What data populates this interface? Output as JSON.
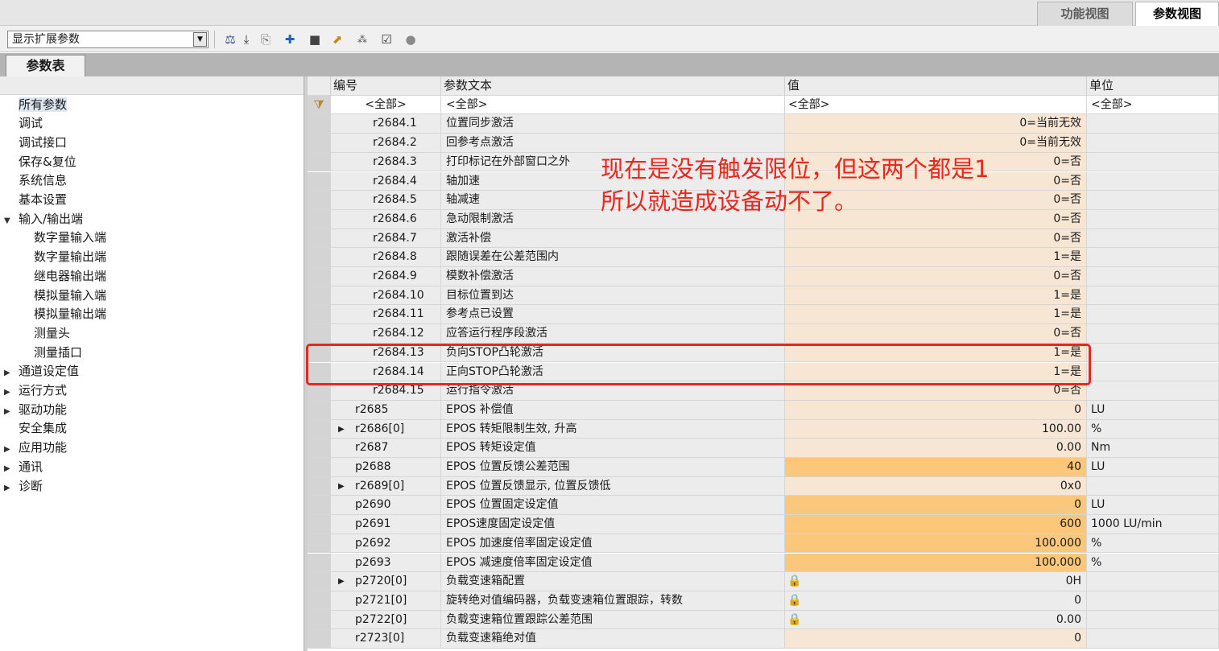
{
  "view_tabs": [
    "功能视图",
    "参数视图"
  ],
  "toolbar": {
    "dropdown_value": "显示扩展参数",
    "icons": [
      "compare-icon",
      "download-icon",
      "copy-to-icon",
      "new-icon",
      "save-icon",
      "export-icon",
      "sort-icon",
      "checkbox-icon",
      "status-dot-icon"
    ]
  },
  "tab_label": "参数表",
  "tree": [
    {
      "label": "所有参数",
      "level": 0,
      "arrow": "",
      "selected": true
    },
    {
      "label": "调试",
      "level": 0,
      "arrow": ""
    },
    {
      "label": "调试接口",
      "level": 0,
      "arrow": ""
    },
    {
      "label": "保存&复位",
      "level": 0,
      "arrow": ""
    },
    {
      "label": "系统信息",
      "level": 0,
      "arrow": ""
    },
    {
      "label": "基本设置",
      "level": 0,
      "arrow": ""
    },
    {
      "label": "输入/输出端",
      "level": 0,
      "arrow": "▼"
    },
    {
      "label": "数字量输入端",
      "level": 1,
      "arrow": ""
    },
    {
      "label": "数字量输出端",
      "level": 1,
      "arrow": ""
    },
    {
      "label": "继电器输出端",
      "level": 1,
      "arrow": ""
    },
    {
      "label": "模拟量输入端",
      "level": 1,
      "arrow": ""
    },
    {
      "label": "模拟量输出端",
      "level": 1,
      "arrow": ""
    },
    {
      "label": "测量头",
      "level": 1,
      "arrow": ""
    },
    {
      "label": "测量插口",
      "level": 1,
      "arrow": ""
    },
    {
      "label": "通道设定值",
      "level": 0,
      "arrow": "▶"
    },
    {
      "label": "运行方式",
      "level": 0,
      "arrow": "▶"
    },
    {
      "label": "驱动功能",
      "level": 0,
      "arrow": "▶"
    },
    {
      "label": "安全集成",
      "level": 0,
      "arrow": ""
    },
    {
      "label": "应用功能",
      "level": 0,
      "arrow": "▶"
    },
    {
      "label": "通讯",
      "level": 0,
      "arrow": "▶"
    },
    {
      "label": "诊断",
      "level": 0,
      "arrow": "▶"
    }
  ],
  "columns": {
    "number": "编号",
    "text": "参数文本",
    "value": "值",
    "unit": "单位"
  },
  "filter": {
    "number": "<全部>",
    "text": "<全部>",
    "value": "<全部>",
    "unit": "<全部>"
  },
  "rows": [
    {
      "num": "r2684.1",
      "text": "位置同步激活",
      "value": "0=当前无效",
      "unit": "",
      "style": "sub"
    },
    {
      "num": "r2684.2",
      "text": "回参考点激活",
      "value": "0=当前无效",
      "unit": "",
      "style": "sub"
    },
    {
      "num": "r2684.3",
      "text": "打印标记在外部窗口之外",
      "value": "0=否",
      "unit": "",
      "style": "sub"
    },
    {
      "num": "r2684.4",
      "text": "轴加速",
      "value": "0=否",
      "unit": "",
      "style": "sub"
    },
    {
      "num": "r2684.5",
      "text": "轴减速",
      "value": "0=否",
      "unit": "",
      "style": "sub"
    },
    {
      "num": "r2684.6",
      "text": "急动限制激活",
      "value": "0=否",
      "unit": "",
      "style": "sub"
    },
    {
      "num": "r2684.7",
      "text": "激活补偿",
      "value": "0=否",
      "unit": "",
      "style": "sub"
    },
    {
      "num": "r2684.8",
      "text": "跟随误差在公差范围内",
      "value": "1=是",
      "unit": "",
      "style": "sub"
    },
    {
      "num": "r2684.9",
      "text": "模数补偿激活",
      "value": "0=否",
      "unit": "",
      "style": "sub"
    },
    {
      "num": "r2684.10",
      "text": "目标位置到达",
      "value": "1=是",
      "unit": "",
      "style": "sub"
    },
    {
      "num": "r2684.11",
      "text": "参考点已设置",
      "value": "1=是",
      "unit": "",
      "style": "sub"
    },
    {
      "num": "r2684.12",
      "text": "应答运行程序段激活",
      "value": "0=否",
      "unit": "",
      "style": "sub"
    },
    {
      "num": "r2684.13",
      "text": "负向STOP凸轮激活",
      "value": "1=是",
      "unit": "",
      "style": "sub"
    },
    {
      "num": "r2684.14",
      "text": "正向STOP凸轮激活",
      "value": "1=是",
      "unit": "",
      "style": "sub"
    },
    {
      "num": "r2684.15",
      "text": "运行指令激活",
      "value": "0=否",
      "unit": "",
      "style": "sub"
    },
    {
      "num": "r2685",
      "text": "EPOS 补偿值",
      "value": "0",
      "unit": "LU",
      "style": "read"
    },
    {
      "num": "r2686[0]",
      "text": "EPOS 转矩限制生效, 升高",
      "value": "100.00",
      "unit": "%",
      "style": "read",
      "expand": true
    },
    {
      "num": "r2687",
      "text": "EPOS 转矩设定值",
      "value": "0.00",
      "unit": "Nm",
      "style": "read"
    },
    {
      "num": "p2688",
      "text": "EPOS 位置反馈公差范围",
      "value": "40",
      "unit": "LU",
      "style": "edit"
    },
    {
      "num": "r2689[0]",
      "text": "EPOS 位置反馈显示, 位置反馈低",
      "value": "0x0",
      "unit": "",
      "style": "read",
      "expand": true
    },
    {
      "num": "p2690",
      "text": "EPOS 位置固定设定值",
      "value": "0",
      "unit": "LU",
      "style": "edit"
    },
    {
      "num": "p2691",
      "text": "EPOS速度固定设定值",
      "value": "600",
      "unit": "1000 LU/min",
      "style": "edit"
    },
    {
      "num": "p2692",
      "text": "EPOS 加速度倍率固定设定值",
      "value": "100.000",
      "unit": "%",
      "style": "edit"
    },
    {
      "num": "p2693",
      "text": "EPOS 减速度倍率固定设定值",
      "value": "100.000",
      "unit": "%",
      "style": "edit"
    },
    {
      "num": "p2720[0]",
      "text": "负载变速箱配置",
      "value": "0H",
      "unit": "",
      "style": "lock",
      "expand": true
    },
    {
      "num": "p2721[0]",
      "text": "旋转绝对值编码器，负载变速箱位置跟踪，转数",
      "value": "0",
      "unit": "",
      "style": "lock"
    },
    {
      "num": "p2722[0]",
      "text": "负载变速箱位置跟踪公差范围",
      "value": "0.00",
      "unit": "",
      "style": "lock"
    },
    {
      "num": "r2723[0]",
      "text": "负载变速箱绝对值",
      "value": "0",
      "unit": "",
      "style": "read"
    }
  ],
  "annotation": [
    "现在是没有触发限位，但这两个都是1",
    "所以就造成设备动不了。"
  ],
  "colors": {
    "highlight": "#e8271e",
    "editable_value": "#fbc77a",
    "readonly_value": "#f7e6d3"
  }
}
